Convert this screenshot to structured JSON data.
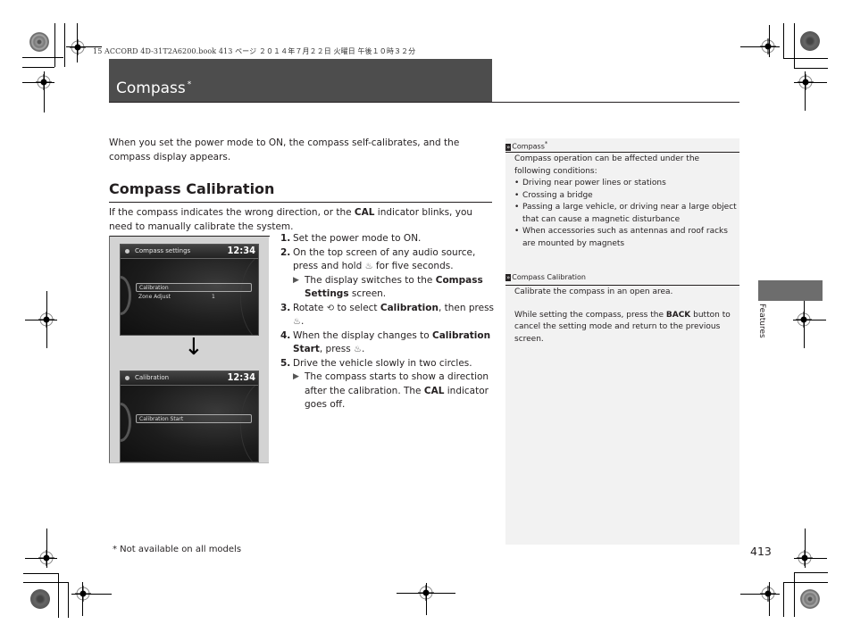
{
  "print_header": "15 ACCORD 4D-31T2A6200.book  413 ページ  ２０１４年７月２２日  火曜日  午後１０時３２分",
  "section_title": "Compass",
  "section_title_marker": "*",
  "intro_text": "When you set the power mode to ON, the compass self-calibrates, and the compass display appears.",
  "subsection": {
    "heading": "Compass Calibration",
    "para_before": "If the compass indicates the wrong direction, or the ",
    "para_bold": "CAL",
    "para_after": " indicator blinks, you need to manually calibrate the system."
  },
  "figure": {
    "screen1": {
      "title": "Compass settings",
      "clock": "12:34",
      "rows": [
        {
          "label": "Calibration",
          "value": "",
          "selected": true
        },
        {
          "label": "Zone Adjust",
          "value": "1",
          "selected": false
        }
      ]
    },
    "arrow_icon": "down-arrow-icon",
    "screen2": {
      "title": "Calibration",
      "clock": "12:34",
      "rows": [
        {
          "label": "Calibration Start",
          "value": "",
          "selected": true
        }
      ]
    }
  },
  "steps": [
    {
      "num": "1.",
      "parts": [
        "Set the power mode to ON."
      ]
    },
    {
      "num": "2.",
      "parts": [
        "On the top screen of any audio source, press and hold ",
        " for five seconds."
      ],
      "icon": "selector-knob-press-icon"
    },
    {
      "num": "2a",
      "sub": true,
      "before": "The display switches to the ",
      "bold": "Compass Settings",
      "after": " screen."
    },
    {
      "num": "3.",
      "before": "Rotate ",
      "icon1": "selector-knob-rotate-icon",
      "mid": " to select ",
      "bold": "Calibration",
      "after": ", then press ",
      "icon2": "selector-knob-press-icon",
      "end": "."
    },
    {
      "num": "4.",
      "before": "When the display changes to ",
      "bold": "Calibration Start",
      "after": ", press ",
      "icon": "selector-knob-press-icon",
      "end": "."
    },
    {
      "num": "5.",
      "parts": [
        "Drive the vehicle slowly in two circles."
      ]
    },
    {
      "num": "5a",
      "sub": true,
      "before": "The compass starts to show a direction after the calibration. The ",
      "bold": "CAL",
      "after": " indicator goes off."
    }
  ],
  "step_texts": {
    "s1": "Set the power mode to ON.",
    "s2a": "On the top screen of any audio source, press and hold",
    "s2b": "for five seconds.",
    "s2sub_a": "The display switches to the",
    "s2sub_b": "Compass Settings",
    "s2sub_c": "screen.",
    "s3a": "Rotate",
    "s3b": "to select",
    "s3c": "Calibration",
    "s3d": ", then press",
    "s4a": "When the display changes to",
    "s4b": "Calibration Start",
    "s4c": ", press",
    "s5": "Drive the vehicle slowly in two circles.",
    "s5sub_a": "The compass starts to show a direction after the calibration. The",
    "s5sub_b": "CAL",
    "s5sub_c": "indicator goes off.",
    "nums": [
      "1.",
      "2.",
      "3.",
      "4.",
      "5."
    ]
  },
  "notes": [
    {
      "title": "Compass",
      "title_marker": "*",
      "intro": "Compass operation can be affected under the following conditions:",
      "bullets": [
        "Driving near power lines or stations",
        "Crossing a bridge",
        "Passing a large vehicle, or driving near a large object that can cause a magnetic disturbance",
        "When accessories such as antennas and roof racks are mounted by magnets"
      ]
    },
    {
      "title": "Compass Calibration",
      "p1": "Calibrate the compass in an open area.",
      "p2_before": "While setting the compass, press the ",
      "p2_bold": "BACK",
      "p2_after": " button to cancel the setting mode and return to the previous screen."
    }
  ],
  "side_tab": "Features",
  "footnote": "* Not available on all models",
  "page_number": "413"
}
